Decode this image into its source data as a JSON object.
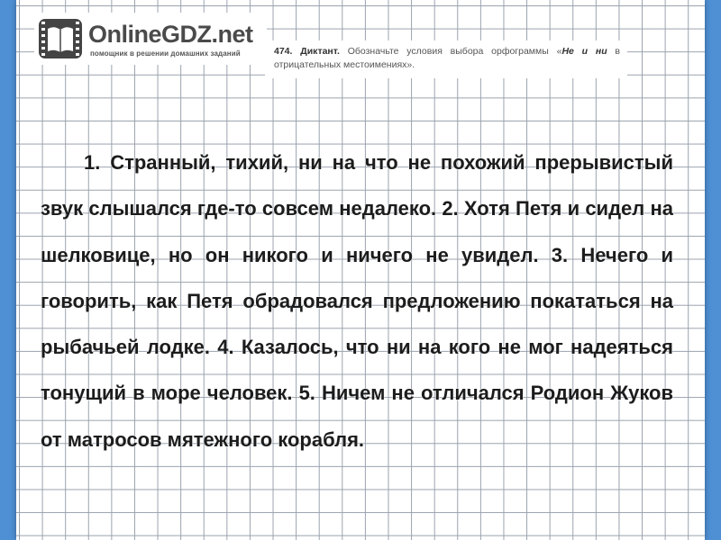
{
  "logo": {
    "name": "OnlineGDZ.net",
    "tagline": "помощник в решении домашних заданий",
    "icon": "film-book-icon"
  },
  "task": {
    "number": "474.",
    "title": "Диктант.",
    "text": "Обозначьте условия выбора орфограммы «",
    "emphasis": "Не и ни",
    "text_end": " в отрицательных местоимениях»."
  },
  "dictation": {
    "text": "1. Странный, тихий, ни на что не похожий прерывистый звук слышался где-то совсем недалеко. 2. Хотя Петя и сидел на шелковице, но он никого и ничего не увидел. 3. Нечего и говорить, как Петя обрадовался предложению покататься на рыбачьей лодке. 4. Казалось, что ни на кого не мог надеяться тонущий в море человек. 5. Ничем не отличался Родион Жуков от матросов мятежного корабля."
  },
  "colors": {
    "background": "#4f8fd3",
    "grid_line": "#9aa2ad",
    "text": "#1c1c1c"
  }
}
